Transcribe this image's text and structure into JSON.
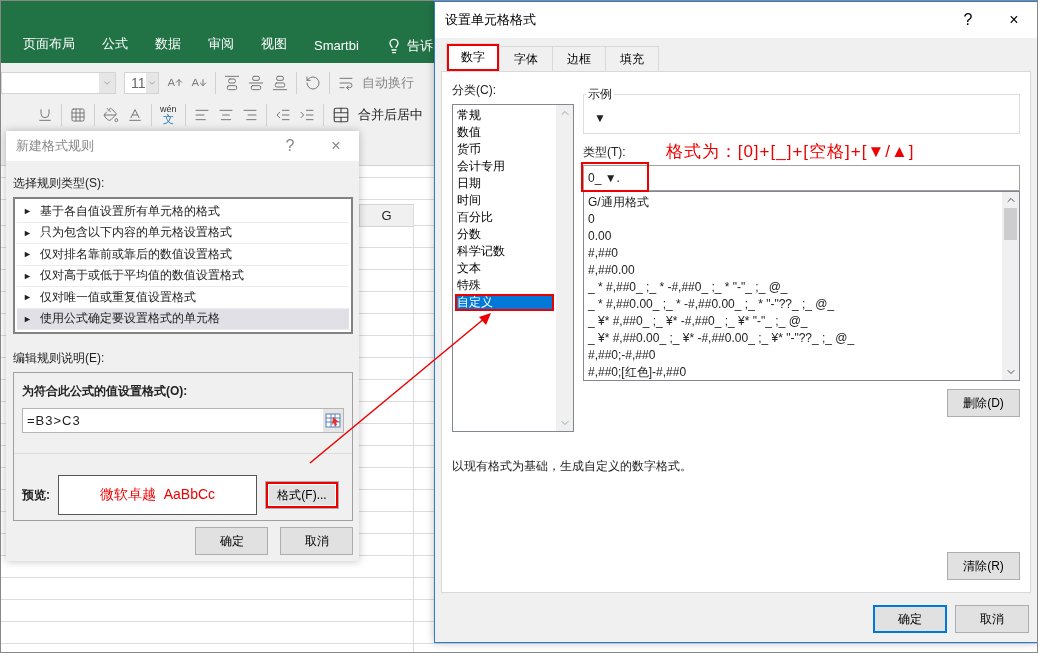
{
  "ribbon": {
    "tabs": [
      {
        "label": "页面布局",
        "selected": false
      },
      {
        "label": "公式",
        "selected": false
      },
      {
        "label": "数据",
        "selected": false
      },
      {
        "label": "审阅",
        "selected": false
      },
      {
        "label": "视图",
        "selected": false
      },
      {
        "label": "Smartbi",
        "selected": false
      }
    ],
    "tell_me": "告诉",
    "font_size": "11",
    "phonetic_top": "wén",
    "phonetic_bottom": "文",
    "wrap_text": "自动换行",
    "merge_center": "合并后居中"
  },
  "sheet": {
    "column_header": "G"
  },
  "rule_dialog": {
    "title": "新建格式规则",
    "help": "?",
    "close": "×",
    "type_label": "选择规则类型(S):",
    "rule_types": [
      {
        "label": "基于各自值设置所有单元格的格式",
        "selected": false
      },
      {
        "label": "只为包含以下内容的单元格设置格式",
        "selected": false
      },
      {
        "label": "仅对排名靠前或靠后的数值设置格式",
        "selected": false
      },
      {
        "label": "仅对高于或低于平均值的数值设置格式",
        "selected": false
      },
      {
        "label": "仅对唯一值或重复值设置格式",
        "selected": false
      },
      {
        "label": "使用公式确定要设置格式的单元格",
        "selected": true
      }
    ],
    "bullet": "►",
    "edit_label": "编辑规则说明(E):",
    "formula_label": "为符合此公式的值设置格式(O):",
    "formula": "=B3>C3",
    "preview_label": "预览:",
    "preview_text": "微软卓越  AaBbCc",
    "format_button": {
      "label": "格式(F)...",
      "highlighted": true
    },
    "buttons": [
      "确定",
      "取消"
    ]
  },
  "format_dialog": {
    "title": "设置单元格格式",
    "help": "?",
    "close": "×",
    "tabs": [
      {
        "label": "数字",
        "selected": true,
        "highlighted": true
      },
      {
        "label": "字体",
        "selected": false,
        "highlighted": false
      },
      {
        "label": "边框",
        "selected": false,
        "highlighted": false
      },
      {
        "label": "填充",
        "selected": false,
        "highlighted": false
      }
    ],
    "category_label": "分类(C):",
    "categories": [
      {
        "label": "常规",
        "selected": false,
        "highlighted": false
      },
      {
        "label": "数值",
        "selected": false,
        "highlighted": false
      },
      {
        "label": "货币",
        "selected": false,
        "highlighted": false
      },
      {
        "label": "会计专用",
        "selected": false,
        "highlighted": false
      },
      {
        "label": "日期",
        "selected": false,
        "highlighted": false
      },
      {
        "label": "时间",
        "selected": false,
        "highlighted": false
      },
      {
        "label": "百分比",
        "selected": false,
        "highlighted": false
      },
      {
        "label": "分数",
        "selected": false,
        "highlighted": false
      },
      {
        "label": "科学记数",
        "selected": false,
        "highlighted": false
      },
      {
        "label": "文本",
        "selected": false,
        "highlighted": false
      },
      {
        "label": "特殊",
        "selected": false,
        "highlighted": false
      },
      {
        "label": "自定义",
        "selected": true,
        "highlighted": true
      }
    ],
    "sample_label": "示例",
    "sample_value": "▼",
    "type_label": "类型(T):",
    "type_field": {
      "value": "0_ ▼.",
      "highlighted": true
    },
    "formats": [
      "G/通用格式",
      "0",
      "0.00",
      "#,##0",
      "#,##0.00",
      "_ * #,##0_ ;_ * -#,##0_ ;_ * \"-\"_ ;_ @_",
      "_ * #,##0.00_ ;_ * -#,##0.00_ ;_ * \"-\"??_ ;_ @_",
      "_ ¥* #,##0_ ;_ ¥* -#,##0_ ;_ ¥* \"-\"_ ;_ @_",
      "_ ¥* #,##0.00_ ;_ ¥* -#,##0.00_ ;_ ¥* \"-\"??_ ;_ @_",
      "#,##0;-#,##0",
      "#,##0;[红色]-#,##0"
    ],
    "delete_button": "删除(D)",
    "description": "以现有格式为基础，生成自定义的数字格式。",
    "clear_button": "清除(R)",
    "buttons": [
      {
        "label": "确定",
        "default": true
      },
      {
        "label": "取消",
        "default": false
      }
    ]
  },
  "annotation": {
    "text": "格式为：[0]+[_]+[空格]+[▼/▲]"
  }
}
